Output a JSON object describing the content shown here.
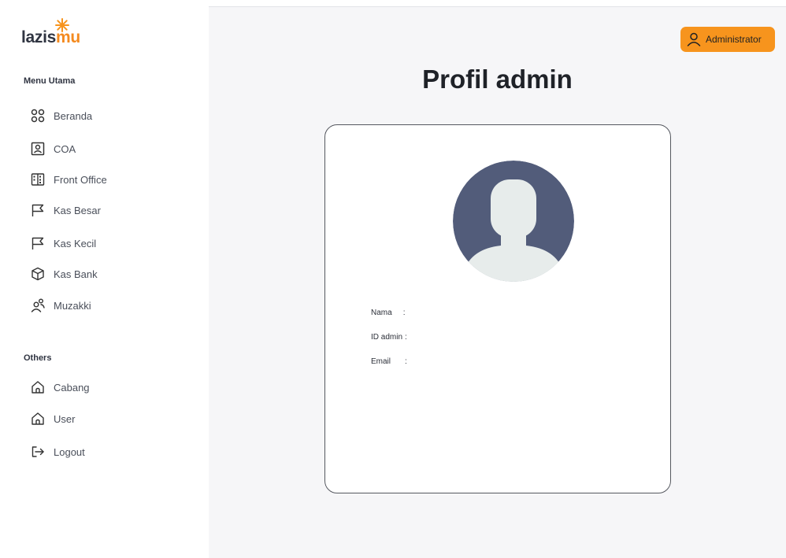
{
  "brand": {
    "logo_dark": "lazis",
    "logo_orange": "mu",
    "accent_color": "#f7941d",
    "avatar_bg": "#525c7a"
  },
  "sidebar": {
    "main_section_title": "Menu Utama",
    "main_items": [
      {
        "label": "Beranda",
        "icon": "grid-icon"
      },
      {
        "label": "COA",
        "icon": "contact-card-icon"
      },
      {
        "label": "Front Office",
        "icon": "building-icon"
      },
      {
        "label": "Kas Besar",
        "icon": "flag-icon"
      },
      {
        "label": "Kas Kecil",
        "icon": "flag-icon"
      },
      {
        "label": "Kas Bank",
        "icon": "box-icon"
      },
      {
        "label": "Muzakki",
        "icon": "users-icon"
      }
    ],
    "others_section_title": "Others",
    "other_items": [
      {
        "label": "Cabang",
        "icon": "home-icon"
      },
      {
        "label": "User",
        "icon": "home-icon"
      },
      {
        "label": "Logout",
        "icon": "logout-icon"
      }
    ]
  },
  "header": {
    "user_button_label": "Administrator",
    "user_icon": "user-icon"
  },
  "main": {
    "title": "Profil admin",
    "profile": {
      "avatar_icon": "avatar-placeholder-icon",
      "fields": [
        {
          "label": "Nama",
          "separator": ":"
        },
        {
          "label": "ID admin",
          "separator": ":"
        },
        {
          "label": "Email",
          "separator": ":"
        }
      ]
    }
  }
}
